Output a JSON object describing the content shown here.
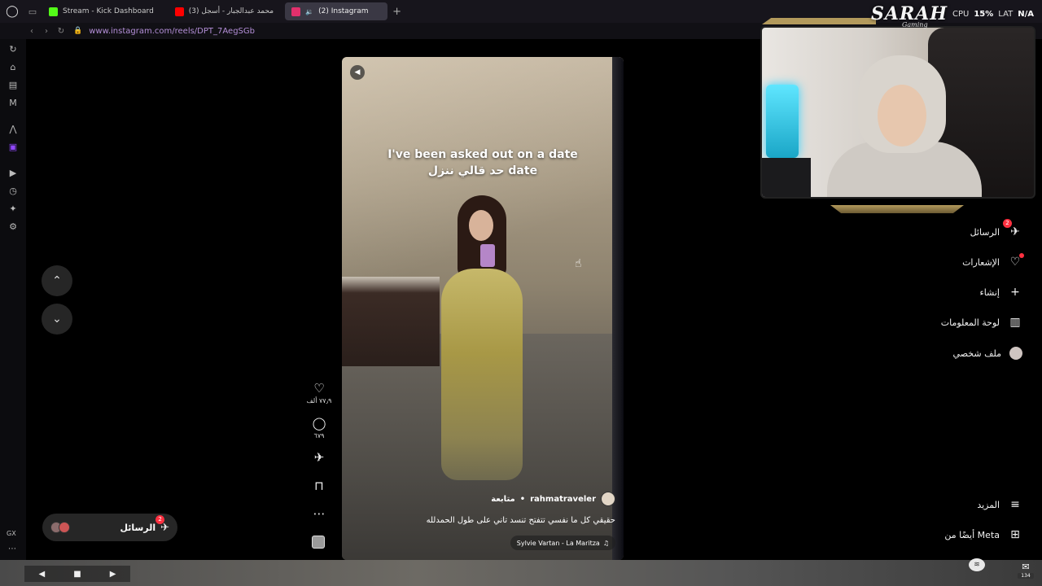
{
  "browser": {
    "tabs": [
      {
        "label": "Stream - Kick Dashboard",
        "favicon_color": "#53fc18"
      },
      {
        "label": "(3) محمد عبدالجبار - أسجل",
        "favicon_color": "#ff0000"
      },
      {
        "label": "(2) Instagram",
        "favicon_color": "#e1306c"
      }
    ],
    "url": "www.instagram.com/reels/DPT_7AegSGb"
  },
  "overlay": {
    "brand": "SARAH",
    "brand_sub": "Gaming",
    "cpu_label": "CPU",
    "cpu_value": "15%",
    "lat_label": "LAT",
    "lat_value": "N/A"
  },
  "reel": {
    "caption_en": "I've been asked out on a date",
    "caption_ar": "حد قالي ننزل date",
    "username": "rahmatraveler",
    "follow_label": "متابعة",
    "description": "حقيقي كل ما نفسي تتفتح تنسد تاني على طول الحمدلله",
    "music": "Sylvie Vartan - La Maritza"
  },
  "actions": {
    "likes": "٧٧٫٩ ألف",
    "comments": "٦٧٩"
  },
  "left_pill": {
    "label": "الرسائل",
    "badge": "2"
  },
  "right_nav": {
    "items": [
      {
        "label": "الرسائل",
        "icon": "send-icon",
        "badge": "2"
      },
      {
        "label": "الإشعارات",
        "icon": "heart-icon"
      },
      {
        "label": "إنشاء",
        "icon": "plus-icon"
      },
      {
        "label": "لوحة المعلومات",
        "icon": "chart-icon"
      },
      {
        "label": "ملف شخصي",
        "icon": "avatar-icon"
      }
    ],
    "more_label": "المزيد",
    "meta_label": "أيضًا من Meta"
  },
  "sidebar": {
    "gx_label": "GX"
  },
  "taskbar": {
    "mail_count": "134"
  }
}
